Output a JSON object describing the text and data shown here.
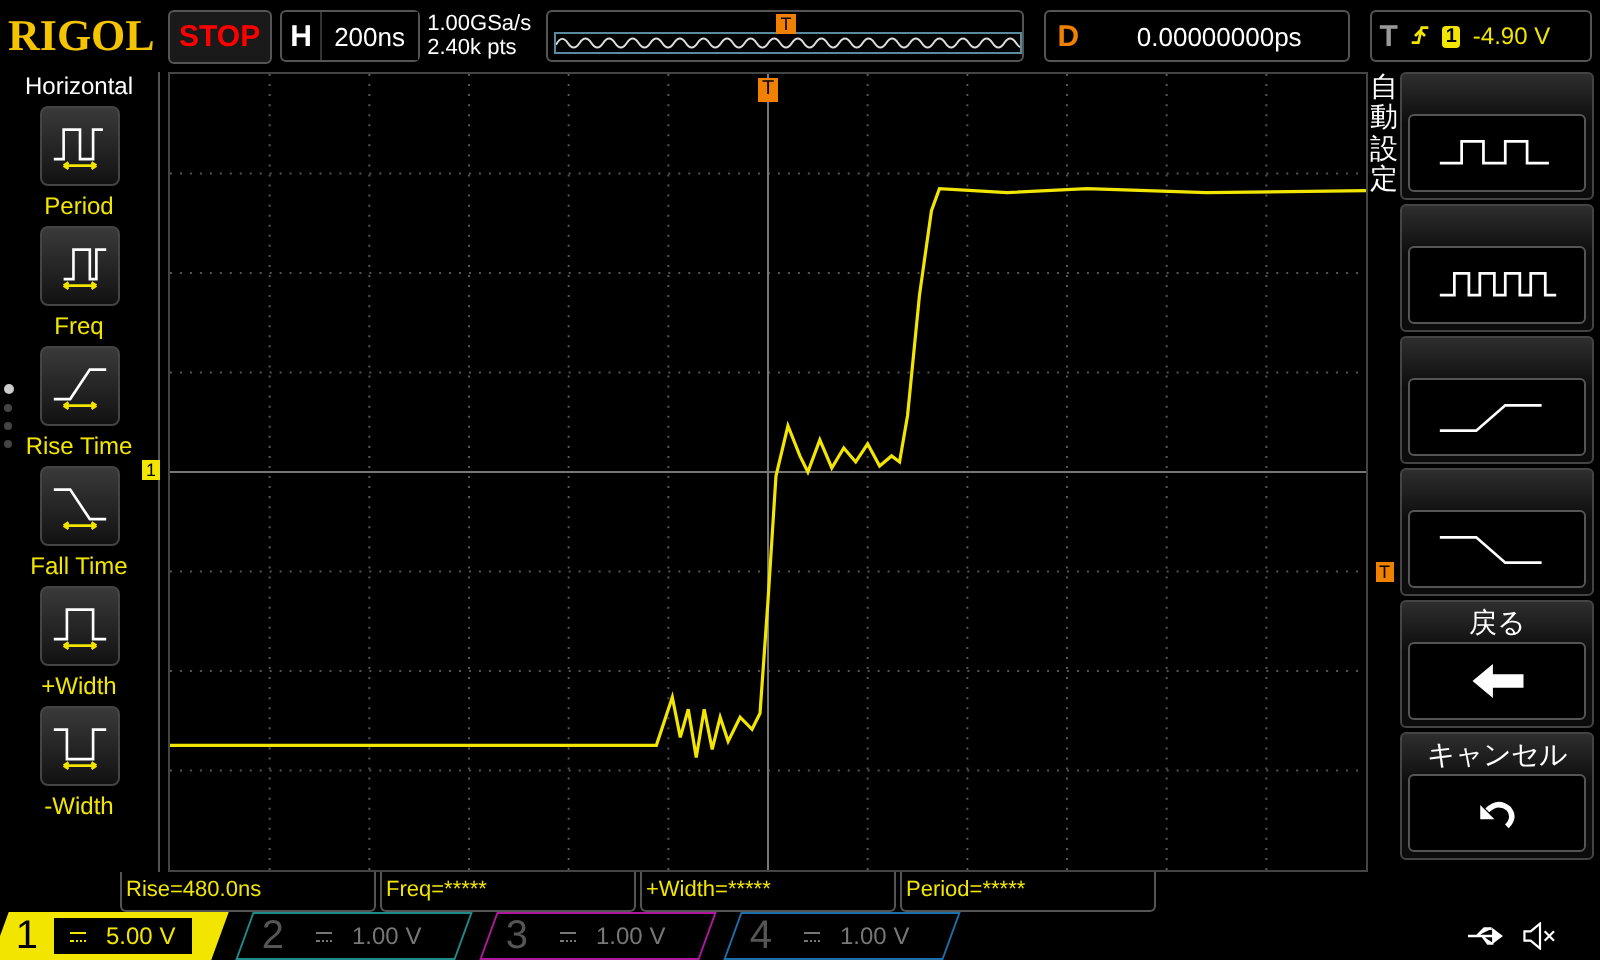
{
  "top_bar": {
    "logo": "RIGOL",
    "run_state": "STOP",
    "timebase": {
      "label": "H",
      "value": "200ns"
    },
    "sample_rate": "1.00GSa/s",
    "memory_depth": "2.40k pts",
    "overview_marker": "T",
    "delay": {
      "label": "D",
      "value": "0.00000000ps"
    },
    "trigger": {
      "label": "T",
      "source": "1",
      "level": "-4.90 V"
    }
  },
  "left_menu": {
    "title": "Horizontal",
    "pages": [
      {
        "selected": true
      },
      {
        "selected": false
      },
      {
        "selected": false
      },
      {
        "selected": false
      }
    ],
    "items": [
      {
        "kind": "period",
        "label": "Period"
      },
      {
        "kind": "freq",
        "label": "Freq"
      },
      {
        "kind": "rise",
        "label": "Rise Time"
      },
      {
        "kind": "fall",
        "label": "Fall Time"
      },
      {
        "kind": "pwidth",
        "label": "+Width"
      },
      {
        "kind": "nwidth",
        "label": "-Width"
      }
    ]
  },
  "screen": {
    "trigger_marker": "T",
    "channel_marker": "1",
    "level_marker": "T"
  },
  "right_menu": {
    "title": "自動設定",
    "keys": [
      {
        "kind": "square"
      },
      {
        "kind": "fast_square"
      },
      {
        "kind": "rise"
      },
      {
        "kind": "fall"
      },
      {
        "kind": "back",
        "label": "戻る"
      },
      {
        "kind": "cancel",
        "label": "キャンセル"
      }
    ]
  },
  "measurements": [
    "Rise=480.0ns",
    "Freq=*****",
    "+Width=*****",
    "Period=*****"
  ],
  "channels": [
    {
      "number": "1",
      "scale": "5.00 V",
      "selected": true,
      "color": "#f2e600"
    },
    {
      "number": "2",
      "scale": "1.00 V",
      "selected": false,
      "color": "#1f8a8a"
    },
    {
      "number": "3",
      "scale": "1.00 V",
      "selected": false,
      "color": "#b0199e"
    },
    {
      "number": "4",
      "scale": "1.00 V",
      "selected": false,
      "color": "#1c6fa8"
    }
  ]
}
